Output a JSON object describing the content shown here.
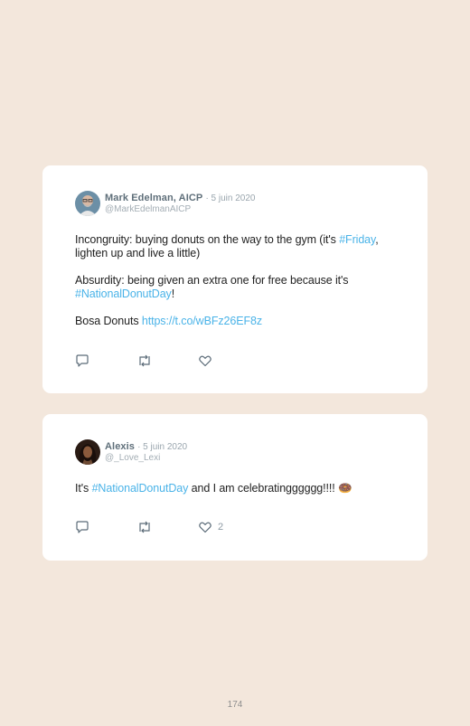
{
  "tweets": [
    {
      "name": "Mark Edelman, AICP",
      "date": "· 5 juin 2020",
      "handle": "@MarkEdelmanAICP",
      "paragraphs": [
        {
          "parts": [
            "Incongruity: buying donuts on the way to the gym (it's ",
            "#Friday",
            ", lighten up and live a little)"
          ]
        },
        {
          "parts": [
            "Absurdity: being given an extra one for free because it's ",
            "#NationalDonutDay",
            "!"
          ]
        },
        {
          "parts": [
            "Bosa Donuts ",
            "https://t.co/wBFz26EF8z"
          ]
        }
      ],
      "actions": {
        "reply_icon": "reply-icon",
        "retweet_icon": "retweet-icon",
        "like_icon": "heart-icon",
        "like_count": ""
      }
    },
    {
      "name": "Alexis",
      "date": "· 5 juin 2020",
      "handle": "@_Love_Lexi",
      "paragraphs": [
        {
          "parts": [
            "It's ",
            "#NationalDonutDay",
            " and I am celebratingggggg!!!! ",
            "🍩"
          ]
        }
      ],
      "actions": {
        "reply_icon": "reply-icon",
        "retweet_icon": "retweet-icon",
        "like_icon": "heart-icon",
        "like_count": "2"
      }
    }
  ],
  "footer": {
    "page_number": "174"
  },
  "colors": {
    "background": "#f3e7dc",
    "card": "#ffffff",
    "link": "#4ab3e8",
    "name": "#5f6f7a",
    "muted": "#a3adb4"
  }
}
